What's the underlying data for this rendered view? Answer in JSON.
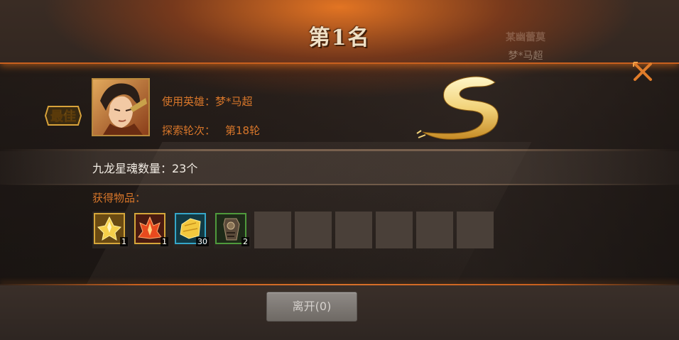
{
  "header": {
    "rank_title": "第1名"
  },
  "ghost": {
    "name": "某幽蕾莫",
    "sub": "梦*马超"
  },
  "best_badge": {
    "text": "最佳"
  },
  "hero": {
    "label": "使用英雄：梦*马超",
    "round_label": "探索轮次：",
    "round_value": "第18轮"
  },
  "grade": {
    "letter": "S"
  },
  "soul": {
    "text": "九龙星魂数量：23个"
  },
  "items": {
    "label": "获得物品：",
    "slots": [
      {
        "count": "1",
        "icon": "gold-crystal-icon"
      },
      {
        "count": "1",
        "icon": "red-crystal-icon"
      },
      {
        "count": "30",
        "icon": "gold-ore-icon"
      },
      {
        "count": "2",
        "icon": "armor-piece-icon"
      }
    ]
  },
  "leave_button": {
    "label": "离开(0)"
  },
  "colors": {
    "accent": "#d7762a",
    "glow": "#c8601e",
    "frame_gold": "#d5a63a"
  }
}
